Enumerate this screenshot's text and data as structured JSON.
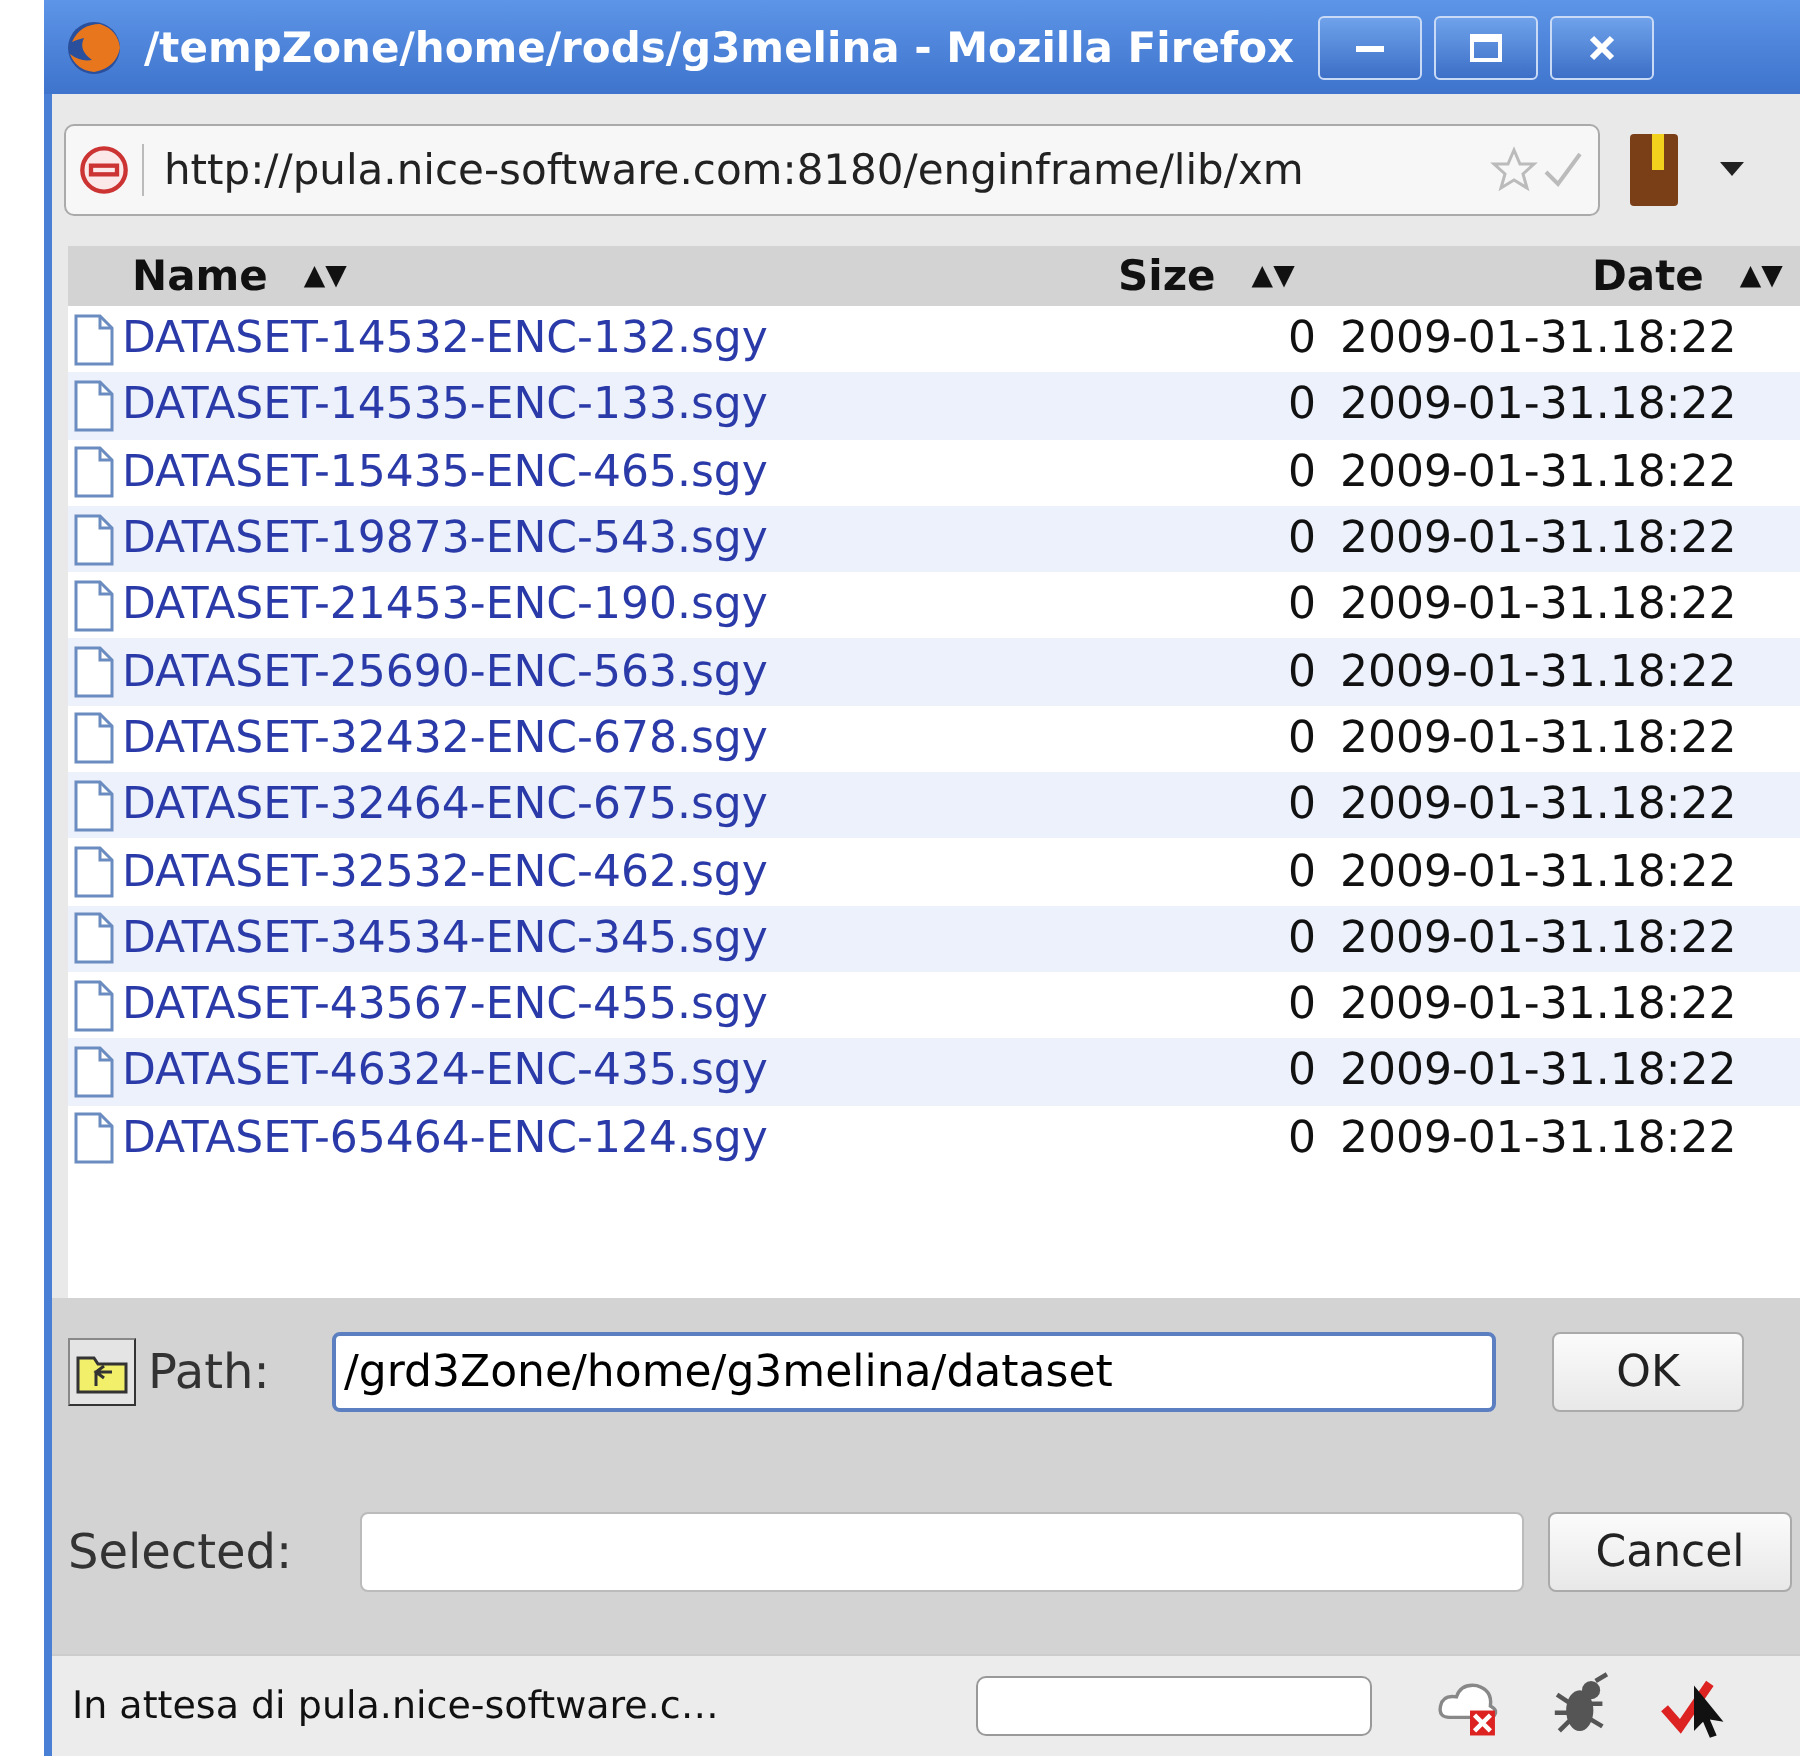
{
  "window": {
    "title": "/tempZone/home/rods/g3melina - Mozilla Firefox"
  },
  "address_bar": {
    "url": "http://pula.nice-software.com:8180/enginframe/lib/xm"
  },
  "table": {
    "columns": [
      {
        "label": "Name",
        "sort": "▲▼"
      },
      {
        "label": "Size",
        "sort": "▲▼"
      },
      {
        "label": "Date",
        "sort": "▲▼"
      }
    ],
    "rows": [
      {
        "name": "DATASET-14532-ENC-132.sgy",
        "size": "0",
        "date": "2009-01-31.18:22"
      },
      {
        "name": "DATASET-14535-ENC-133.sgy",
        "size": "0",
        "date": "2009-01-31.18:22"
      },
      {
        "name": "DATASET-15435-ENC-465.sgy",
        "size": "0",
        "date": "2009-01-31.18:22"
      },
      {
        "name": "DATASET-19873-ENC-543.sgy",
        "size": "0",
        "date": "2009-01-31.18:22"
      },
      {
        "name": "DATASET-21453-ENC-190.sgy",
        "size": "0",
        "date": "2009-01-31.18:22"
      },
      {
        "name": "DATASET-25690-ENC-563.sgy",
        "size": "0",
        "date": "2009-01-31.18:22"
      },
      {
        "name": "DATASET-32432-ENC-678.sgy",
        "size": "0",
        "date": "2009-01-31.18:22"
      },
      {
        "name": "DATASET-32464-ENC-675.sgy",
        "size": "0",
        "date": "2009-01-31.18:22"
      },
      {
        "name": "DATASET-32532-ENC-462.sgy",
        "size": "0",
        "date": "2009-01-31.18:22"
      },
      {
        "name": "DATASET-34534-ENC-345.sgy",
        "size": "0",
        "date": "2009-01-31.18:22"
      },
      {
        "name": "DATASET-43567-ENC-455.sgy",
        "size": "0",
        "date": "2009-01-31.18:22"
      },
      {
        "name": "DATASET-46324-ENC-435.sgy",
        "size": "0",
        "date": "2009-01-31.18:22"
      },
      {
        "name": "DATASET-65464-ENC-124.sgy",
        "size": "0",
        "date": "2009-01-31.18:22"
      }
    ]
  },
  "form": {
    "path_label": "Path:",
    "path_value": "/grd3Zone/home/g3melina/dataset",
    "ok": "OK",
    "selected_label": "Selected:",
    "cancel": "Cancel"
  },
  "status_bar": {
    "text": "In attesa di pula.nice-software.c…"
  }
}
